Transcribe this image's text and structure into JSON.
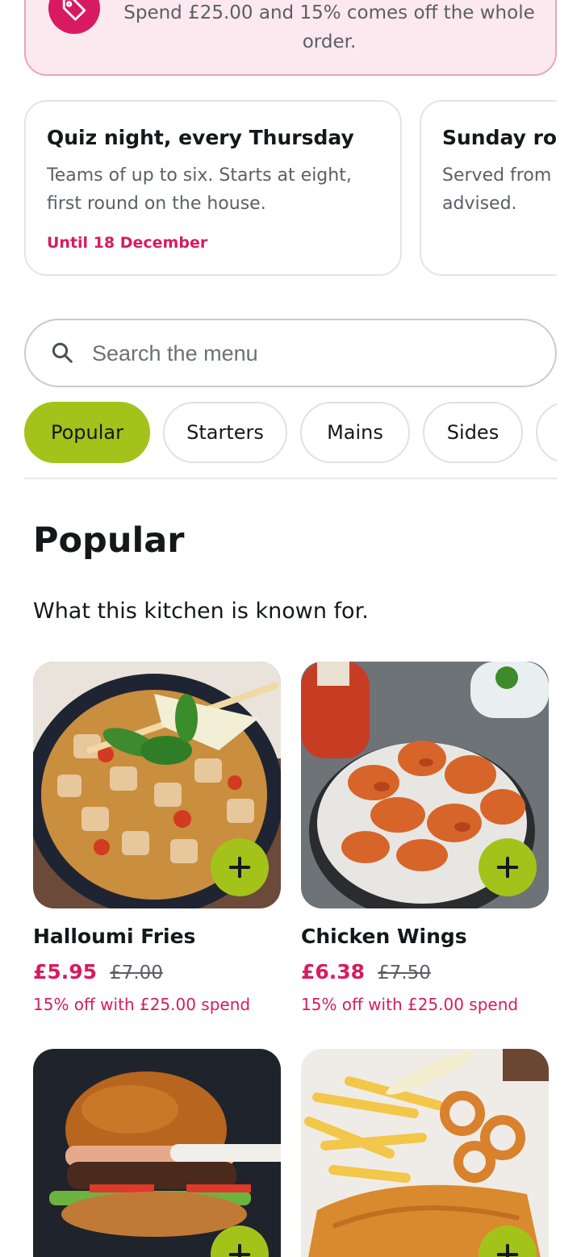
{
  "offer": {
    "text": "Spend £25.00 and 15% comes off the whole order.",
    "icon": "tag-icon",
    "accent": "#d81b60"
  },
  "promos": [
    {
      "title": "Quiz night, every Thursday",
      "body": "Teams of up to six. Starts at eight, first round on the house.",
      "until": "Until 18 December"
    },
    {
      "title": "Sunday roast",
      "body": "Served from midday. Booking advised."
    }
  ],
  "search": {
    "placeholder": "Search the menu",
    "value": ""
  },
  "categories": [
    {
      "label": "Popular",
      "active": true
    },
    {
      "label": "Starters"
    },
    {
      "label": "Mains"
    },
    {
      "label": "Sides"
    },
    {
      "label": ""
    }
  ],
  "section": {
    "title": "Popular",
    "subtitle": "What this kitchen is known for."
  },
  "products": [
    {
      "name": "Halloumi Fries",
      "price": "£5.95",
      "was": "£7.00",
      "note": "15% off with £25.00 spend"
    },
    {
      "name": "Chicken Wings",
      "price": "£6.38",
      "was": "£7.50",
      "note": "15% off with £25.00 spend"
    },
    {
      "name": "",
      "price": "",
      "was": "",
      "note": ""
    },
    {
      "name": "",
      "price": "",
      "was": "",
      "note": ""
    }
  ],
  "colors": {
    "brand_green": "#a3c31b",
    "brand_pink": "#d81b60"
  }
}
